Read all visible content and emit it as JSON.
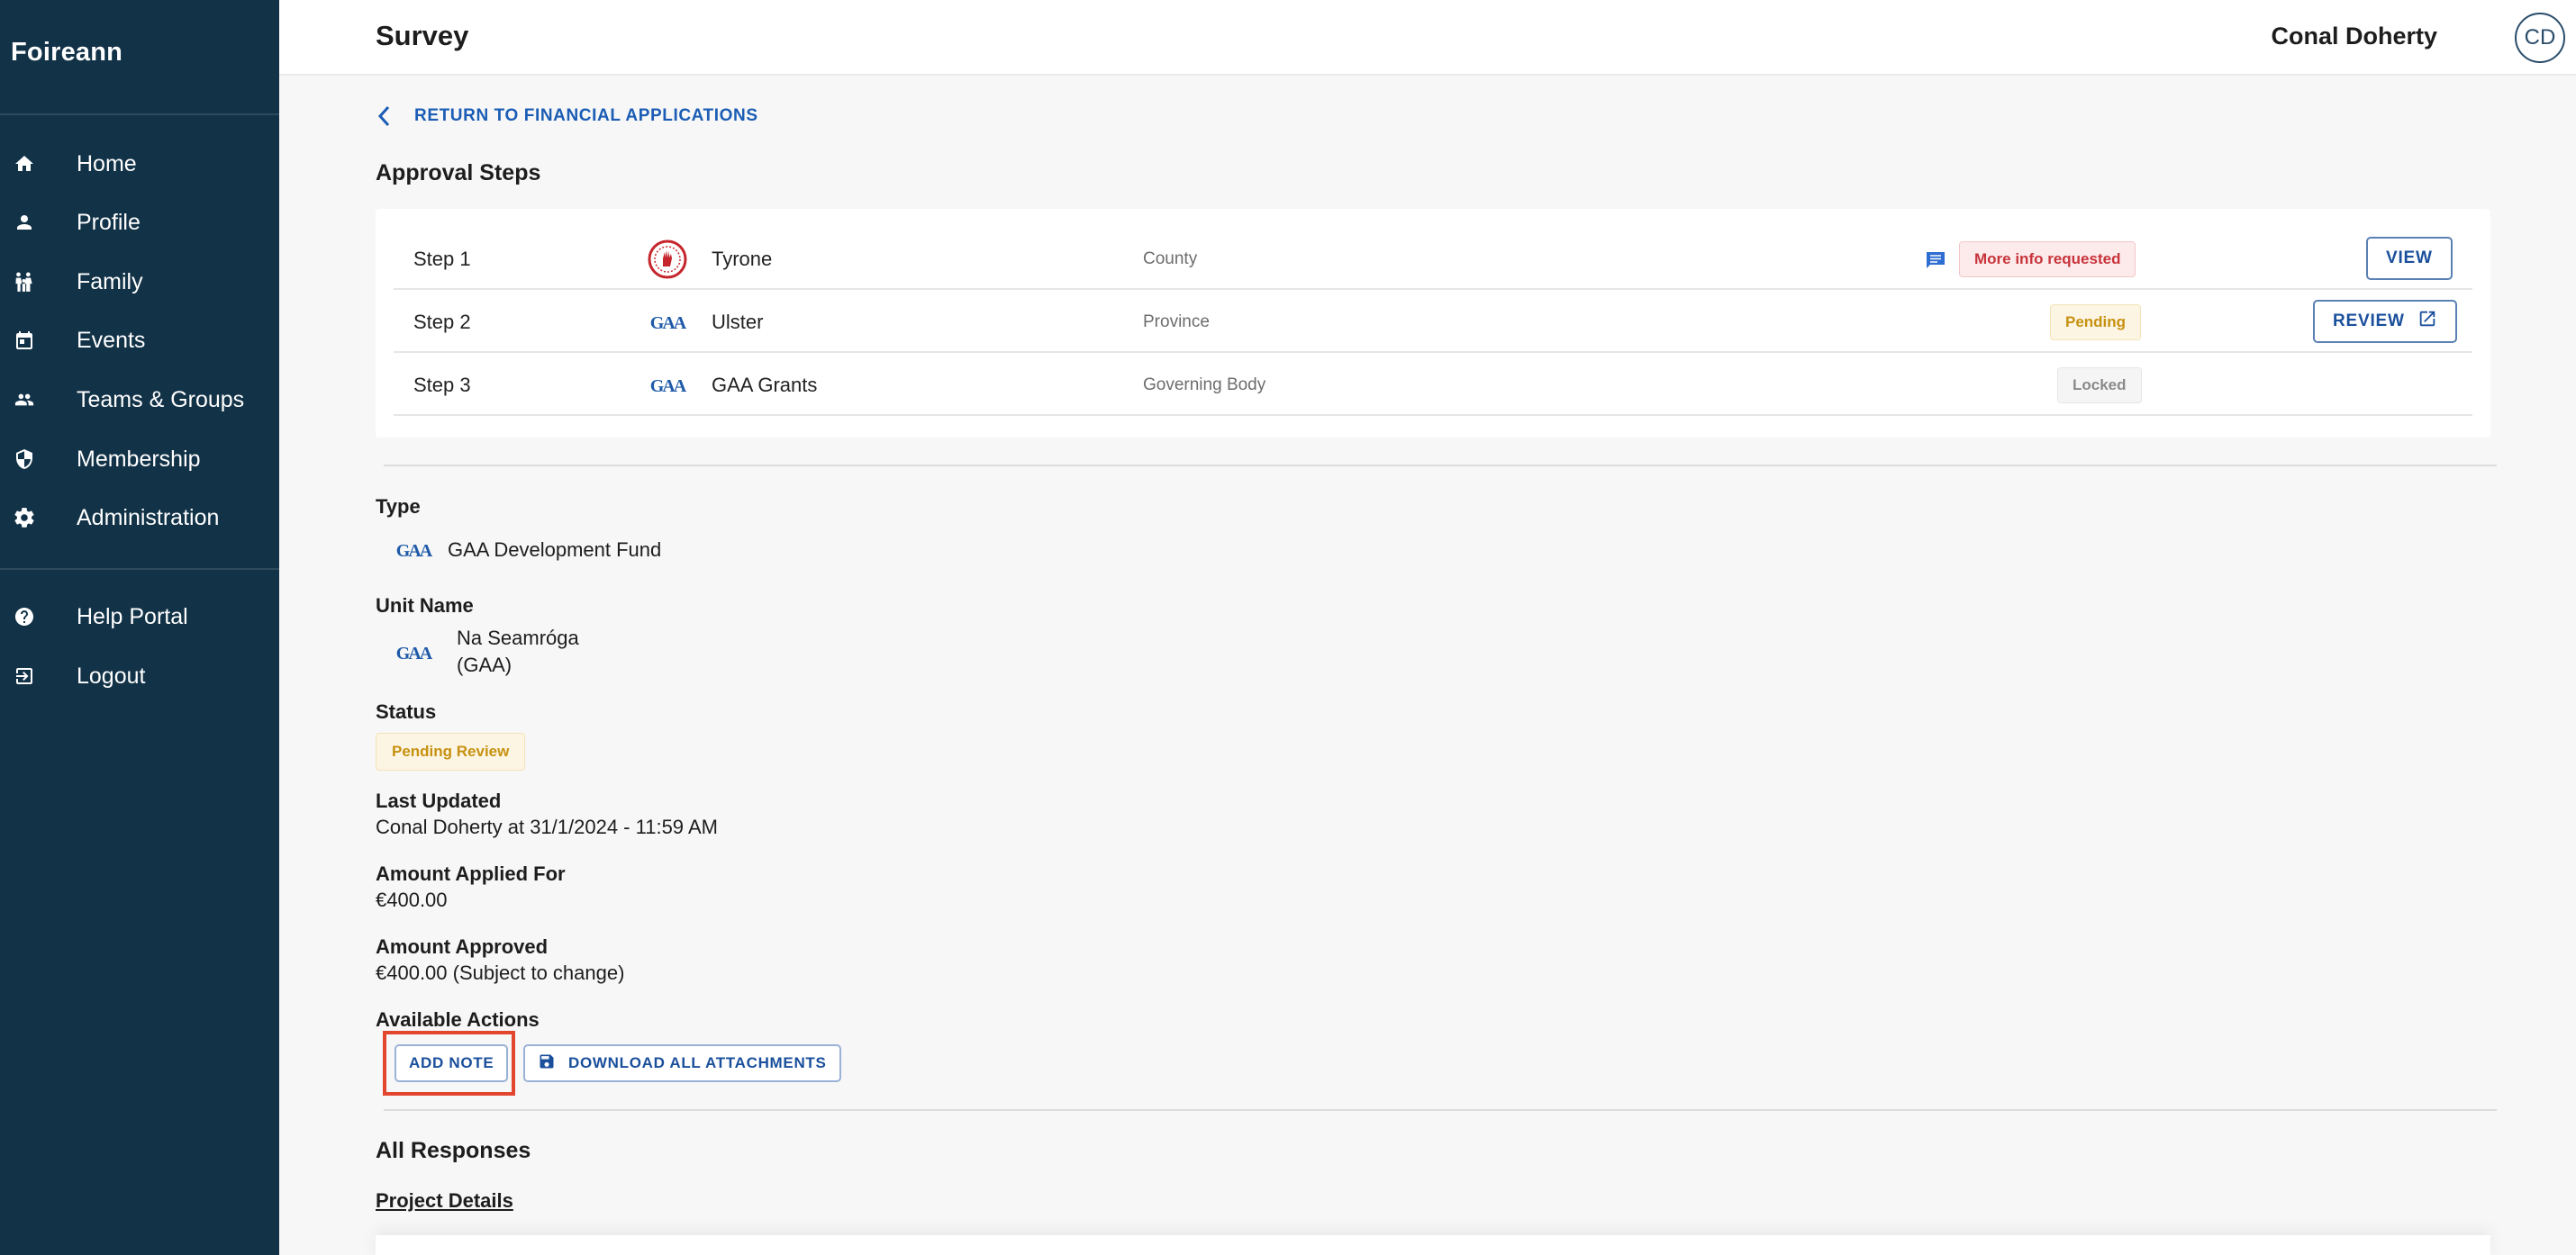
{
  "app": {
    "brand": "Foireann"
  },
  "header": {
    "title": "Survey",
    "user_name": "Conal Doherty",
    "user_initials": "CD"
  },
  "sidebar": {
    "items": [
      {
        "label": "Home",
        "icon": "home-icon"
      },
      {
        "label": "Profile",
        "icon": "person-icon"
      },
      {
        "label": "Family",
        "icon": "family-icon"
      },
      {
        "label": "Events",
        "icon": "calendar-icon"
      },
      {
        "label": "Teams & Groups",
        "icon": "group-icon"
      },
      {
        "label": "Membership",
        "icon": "shield-icon"
      },
      {
        "label": "Administration",
        "icon": "gear-icon"
      }
    ],
    "footer_items": [
      {
        "label": "Help Portal",
        "icon": "help-icon"
      },
      {
        "label": "Logout",
        "icon": "logout-icon"
      }
    ]
  },
  "main": {
    "back_link": "RETURN TO FINANCIAL APPLICATIONS",
    "approval_title": "Approval Steps",
    "steps": [
      {
        "step": "Step 1",
        "org": "Tyrone",
        "level": "County",
        "status": "More info requested",
        "action": "VIEW"
      },
      {
        "step": "Step 2",
        "org": "Ulster",
        "level": "Province",
        "status": "Pending",
        "action": "REVIEW"
      },
      {
        "step": "Step 3",
        "org": "GAA Grants",
        "level": "Governing Body",
        "status": "Locked",
        "action": ""
      }
    ],
    "details": {
      "type_label": "Type",
      "type_value": "GAA Development Fund",
      "unit_label": "Unit Name",
      "unit_value_line1": "Na Seamróga",
      "unit_value_line2": "(GAA)",
      "status_label": "Status",
      "status_value": "Pending Review",
      "updated_label": "Last Updated",
      "updated_value": "Conal Doherty at 31/1/2024 - 11:59 AM",
      "applied_label": "Amount Applied For",
      "applied_value": "€400.00",
      "approved_label": "Amount Approved",
      "approved_value": "€400.00 (Subject to change)",
      "actions_label": "Available Actions"
    },
    "actions": {
      "add_note": "ADD NOTE",
      "download": "DOWNLOAD ALL ATTACHMENTS"
    },
    "responses_title": "All Responses",
    "project_details": "Project Details"
  },
  "colors": {
    "sidebar_bg": "#123247",
    "link_blue": "#1b5db5",
    "chip_red": "#c7343b",
    "chip_amber": "#c69110",
    "highlight": "#e2462f"
  }
}
